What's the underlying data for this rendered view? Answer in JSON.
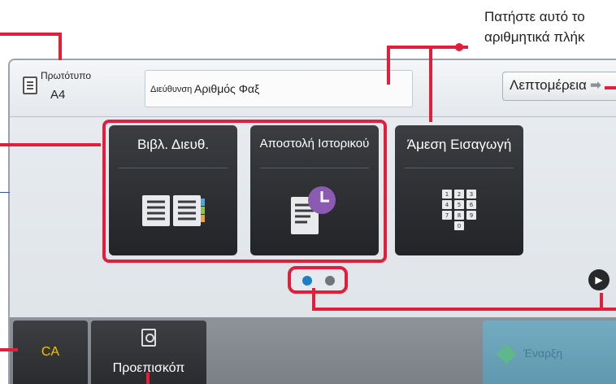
{
  "callout": {
    "line1": "Πατήστε αυτό το",
    "line2": "αριθμητικά πλήκ"
  },
  "topbar": {
    "original_label": "Πρωτότυπο",
    "original_value": "A4",
    "address_label": "Διεύθυνση",
    "address_value": "Αριθμός Φαξ",
    "details_label": "Λεπτομέρεια"
  },
  "tiles": [
    {
      "label": "Βιβλ. Διευθ.",
      "icon": "address-book-icon"
    },
    {
      "label": "Αποστολή Ιστορικού",
      "icon": "history-clock-icon"
    },
    {
      "label": "Άμεση Εισαγωγή",
      "icon": "numeric-keypad-icon"
    }
  ],
  "pager": {
    "pages": 2,
    "current": 1,
    "active_color": "#1e7fc8",
    "inactive_color": "#6f757b"
  },
  "bottombar": {
    "ca_label": "CA",
    "preview_label": "Προεπισκόπ",
    "start_label": "Έναρξη"
  },
  "colors": {
    "highlight": "#e21f3b",
    "tile_bg": "#2d2f32",
    "ca_text": "#f4c400"
  },
  "keypad_keys": [
    "1",
    "2",
    "3",
    "4",
    "5",
    "6",
    "7",
    "8",
    "9",
    "0"
  ]
}
